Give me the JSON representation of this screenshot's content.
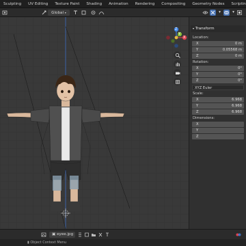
{
  "workspace_tabs": [
    "Sculpting",
    "UV Editing",
    "Texture Paint",
    "Shading",
    "Animation",
    "Rendering",
    "Compositing",
    "Geometry Nodes",
    "Scripting"
  ],
  "header": {
    "orientation_label": "Global"
  },
  "viewport": {
    "gizmo": {
      "x_label": "X",
      "y_label": "Y",
      "z_label": "Z"
    }
  },
  "transform_panel": {
    "title": "Transform",
    "location_label": "Location:",
    "location": [
      {
        "axis": "X",
        "value": "0 m"
      },
      {
        "axis": "Y",
        "value": "0.05568 m"
      },
      {
        "axis": "Z",
        "value": "0 m"
      }
    ],
    "rotation_label": "Rotation:",
    "rotation": [
      {
        "axis": "X",
        "value": "0°"
      },
      {
        "axis": "Y",
        "value": "0°"
      },
      {
        "axis": "Z",
        "value": "0°"
      }
    ],
    "rotation_mode": "XYZ Euler",
    "scale_label": "Scale:",
    "scale": [
      {
        "axis": "X",
        "value": "6.968"
      },
      {
        "axis": "Y",
        "value": "6.968"
      },
      {
        "axis": "Z",
        "value": "6.968"
      }
    ],
    "dimensions_label": "Dimensions:",
    "dimensions": [
      {
        "axis": "X",
        "value": ""
      },
      {
        "axis": "Y",
        "value": ""
      },
      {
        "axis": "Z",
        "value": ""
      }
    ]
  },
  "image_editor": {
    "image_name": "eyee.jpg"
  },
  "status": {
    "hint": "Object Context Menu"
  },
  "colors": {
    "accent_blue": "#4772b3",
    "axis_red": "#e0414f",
    "axis_green": "#8bc53d",
    "axis_blue": "#3e86e8",
    "viewport_bg": "#393939"
  }
}
